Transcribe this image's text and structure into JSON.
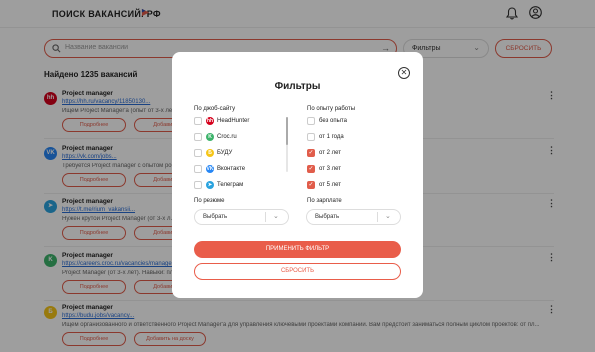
{
  "header": {
    "logo": "ПОИСК ВАКАНСИЙ. РФ"
  },
  "search": {
    "placeholder": "Название вакансии",
    "filters_label": "Фильтры",
    "reset_label": "СБРОСИТЬ"
  },
  "found": "Найдено 1235 вакансий",
  "vacancies": [
    {
      "title": "Project manager",
      "link": "https://hh.ru/vacancy/11850130...",
      "desc": "Ищем Project Manager'а (опыт от 3-х лет)... контроль сроков и бюджета, а также координацией р...",
      "logo_text": "hh",
      "logo_color": "#d6001c",
      "more": "…",
      "btn1": "Подробнее",
      "btn2": "Добавить н..."
    },
    {
      "title": "Project manager",
      "link": "https://vk.com/jobs...",
      "desc": "Требуется Project manager с опытом ро... планированием, контроль сроков и бюджета, ...",
      "logo_text": "VK",
      "logo_color": "#2787f5",
      "more": "…",
      "btn1": "Подробнее",
      "btn2": "Добавить н..."
    },
    {
      "title": "Project manager",
      "link": "https://t.me/rium_vakansii...",
      "desc": "Нужен крутой Project Manager (от 3-х л... от тебя: умение планировать, бюджетировать...",
      "logo_text": "➤",
      "logo_color": "#2aa3df",
      "more": "…",
      "btn1": "Подробнее",
      "btn2": "Добавить н..."
    },
    {
      "title": "Project manager",
      "link": "https://careers.croc.ru/vacancies/manage...",
      "desc": "Project Manager (от 3-х лет). Навыки: пл... Удаленка/гибкий график и классные п...",
      "logo_text": "K",
      "logo_color": "#3db36b",
      "more": "…",
      "btn1": "Подробнее",
      "btn2": "Добавить н..."
    },
    {
      "title": "Project manager",
      "link": "https://budu.jobs/vacancy...",
      "desc": "Ищем организованного и ответственного Project Manager'а для управления ключевыми проектами компании. Вам предстоит заниматься полным циклом проектов: от пл...",
      "logo_text": "Б",
      "logo_color": "#f5c518",
      "more": "…",
      "btn1": "Подробнее",
      "btn2": "Добавить на доску"
    }
  ],
  "modal": {
    "title": "Фильтры",
    "close_icon": "close-icon",
    "site_title": "По джоб-сайту",
    "sites": [
      {
        "label": "HeadHunter",
        "icon_text": "hh",
        "color": "#d6001c",
        "checked": false
      },
      {
        "label": "Croc.ru",
        "icon_text": "K",
        "color": "#3db36b",
        "checked": false
      },
      {
        "label": "БУДУ",
        "icon_text": "Б",
        "color": "#f5c518",
        "checked": false
      },
      {
        "label": "Вконтакте",
        "icon_text": "VK",
        "color": "#2787f5",
        "checked": false
      },
      {
        "label": "Телеграм",
        "icon_text": "➤",
        "color": "#2aa3df",
        "checked": false
      }
    ],
    "exp_title": "По опыту работы",
    "experience": [
      {
        "label": "без опыта",
        "checked": false
      },
      {
        "label": "от 1 года",
        "checked": false
      },
      {
        "label": "от 2 лет",
        "checked": true
      },
      {
        "label": "от 3 лет",
        "checked": true
      },
      {
        "label": "от 5 лет",
        "checked": true
      }
    ],
    "resume_title": "По резюме",
    "resume_value": "Выбрать",
    "salary_title": "По зарплате",
    "salary_value": "Выбрать",
    "apply_label": "ПРИМЕНИТЬ ФИЛЬТР",
    "reset_label": "СБРОСИТЬ"
  },
  "colors": {
    "accent": "#e95d4a",
    "link": "#2a6cd4"
  }
}
